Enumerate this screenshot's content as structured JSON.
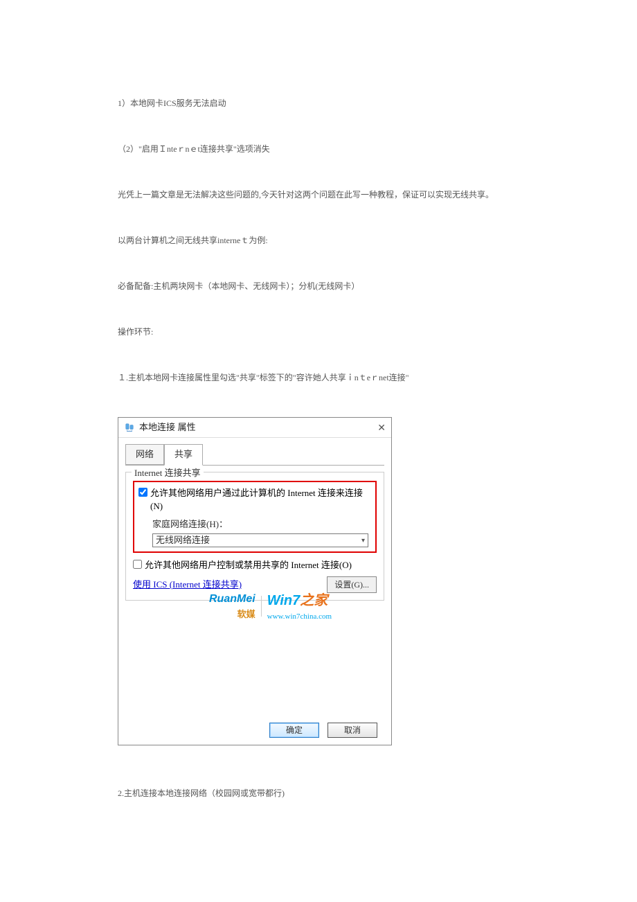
{
  "document": {
    "p1": "1）本地网卡ICS服务无法启动",
    "p2": "（2）\"启用Ｉnteｒnｅt连接共享\"选项消失",
    "p3": "光凭上一篇文章是无法解决这些问题的,今天针对这两个问题在此写一种教程，保证可以实现无线共享。",
    "p4": "以两台计算机之间无线共享interneｔ为例:",
    "p5": "必备配备:主机两块网卡（本地网卡、无线网卡）；分机(无线网卡）",
    "p6": "操作环节:",
    "p7": "１.主机本地网卡连接属性里勾选\"共享\"标签下的\"容许她人共享ｉnｔeｒnet连接\"",
    "p8": "2.主机连接本地连接网络（校园网或宽带都行)"
  },
  "dialog": {
    "title": "本地连接 属性",
    "close": "✕",
    "tabs": {
      "network": "网络",
      "sharing": "共享"
    },
    "group_title": "Internet 连接共享",
    "checkbox1_label": "允许其他网络用户通过此计算机的 Internet 连接来连接(N)",
    "home_network_label": "家庭网络连接(H)：",
    "dropdown_value": "无线网络连接",
    "checkbox2_label": "允许其他网络用户控制或禁用共享的 Internet 连接(O)",
    "ics_link": "使用 ICS (Internet 连接共享)",
    "settings_btn": "设置(G)...",
    "ok": "确定",
    "cancel": "取消",
    "checkbox1_checked": true,
    "checkbox2_checked": false
  },
  "watermark": {
    "ruanmei": "RuanMei",
    "ruanmei_sub": "软媒",
    "win7_a": "Win7",
    "win7_b": "之家",
    "url": "www.win7china.com"
  }
}
